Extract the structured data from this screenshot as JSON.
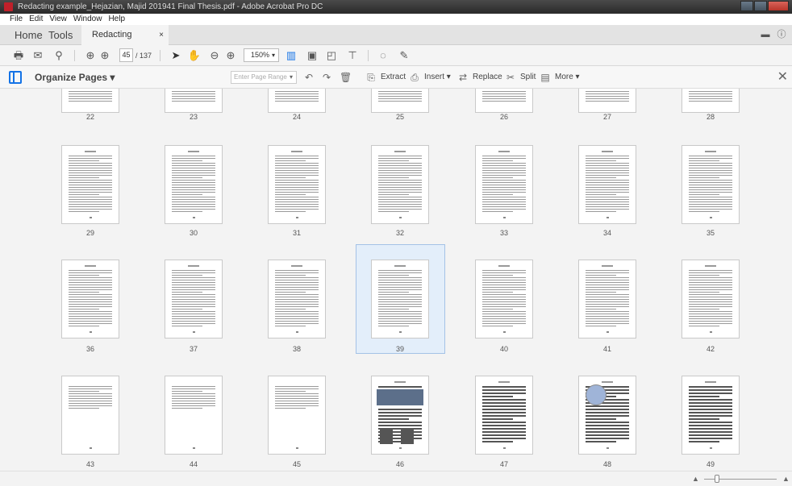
{
  "window": {
    "title": "Redacting example_Hejazian, Majid 201941 Final Thesis.pdf - Adobe Acrobat Pro DC"
  },
  "menu": [
    "File",
    "Edit",
    "View",
    "Window",
    "Help"
  ],
  "tabs": {
    "home": "Home",
    "tools": "Tools",
    "document": "Redacting example_...",
    "close": "×"
  },
  "toolbar": {
    "page_current": "45",
    "page_total": "/ 137",
    "zoom": "150%"
  },
  "organize": {
    "title": "Organize Pages ▾",
    "range_placeholder": "Enter Page Range",
    "extract": "Extract",
    "insert": "Insert ▾",
    "replace": "Replace",
    "split": "Split",
    "more": "More ▾"
  },
  "pages": {
    "rows": [
      [
        "22",
        "23",
        "24",
        "25",
        "26",
        "27",
        "28"
      ],
      [
        "29",
        "30",
        "31",
        "32",
        "33",
        "34",
        "35"
      ],
      [
        "36",
        "37",
        "38",
        "39",
        "40",
        "41",
        "42"
      ],
      [
        "43",
        "44",
        "45",
        "46",
        "47",
        "48",
        "49"
      ]
    ],
    "selected": "39"
  },
  "icons": {
    "print": "print-icon",
    "email": "email-icon",
    "search": "search-icon",
    "prev": "prev-page-icon",
    "next": "next-page-icon",
    "select": "select-cursor-icon",
    "hand": "hand-icon",
    "zoom_out": "zoom-out-icon",
    "zoom_in": "zoom-in-icon",
    "comment": "comment-icon",
    "pen": "pen-icon"
  }
}
